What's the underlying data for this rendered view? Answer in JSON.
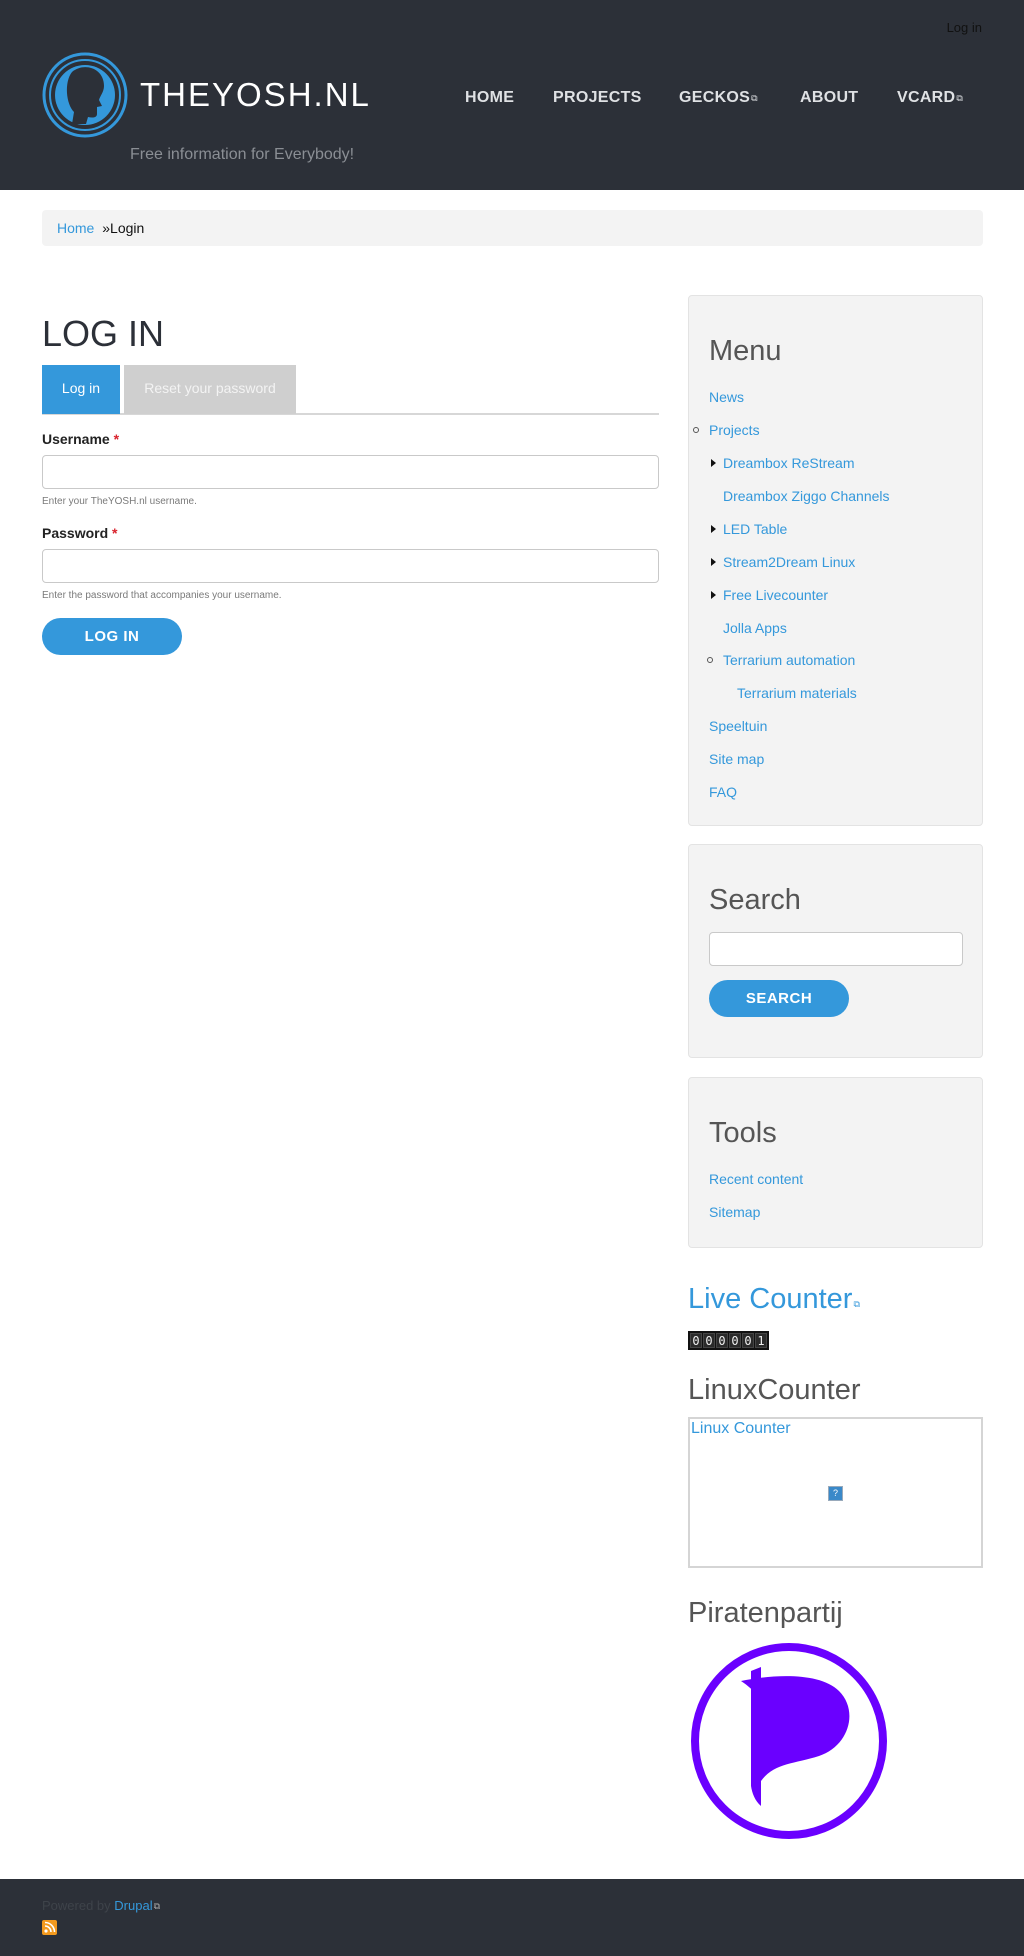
{
  "header": {
    "login_link": "Log in",
    "site_name": "THEYOSH.NL",
    "slogan": "Free information for Everybody!",
    "nav": [
      "HOME",
      "PROJECTS",
      "GECKOS",
      "ABOUT",
      "VCARD"
    ]
  },
  "breadcrumb": {
    "home": "Home",
    "separator": "»",
    "current": "Login"
  },
  "page": {
    "title": "LOG IN",
    "tabs": {
      "login": "Log in",
      "reset": "Reset your password"
    },
    "username_label": "Username",
    "username_required": "*",
    "username_help": "Enter your TheYOSH.nl username.",
    "password_label": "Password",
    "password_required": "*",
    "password_help": "Enter the password that accompanies your username.",
    "submit": "LOG IN"
  },
  "sidebar": {
    "menu": {
      "title": "Menu",
      "items": [
        "News",
        "Projects",
        "Dreambox ReStream",
        "Dreambox Ziggo Channels",
        "LED Table",
        "Stream2Dream Linux",
        "Free Livecounter",
        "Jolla Apps",
        "Terrarium automation",
        "Terrarium materials",
        "Speeltuin",
        "Site map",
        "FAQ"
      ]
    },
    "search": {
      "title": "Search",
      "button": "SEARCH"
    },
    "tools": {
      "title": "Tools",
      "items": [
        "Recent content",
        "Sitemap"
      ]
    },
    "live_counter": {
      "title": "Live Counter",
      "digits": [
        "0",
        "0",
        "0",
        "0",
        "0",
        "1"
      ]
    },
    "linux_counter": {
      "title": "LinuxCounter",
      "link": "Linux Counter",
      "broken_image": "?"
    },
    "pirates": {
      "title": "Piratenpartij"
    }
  },
  "footer": {
    "powered_by": "Powered by",
    "drupal": "Drupal"
  },
  "colors": {
    "accent": "#3498db",
    "header_bg": "#2c3038",
    "pirate_purple": "#6a00ff"
  }
}
